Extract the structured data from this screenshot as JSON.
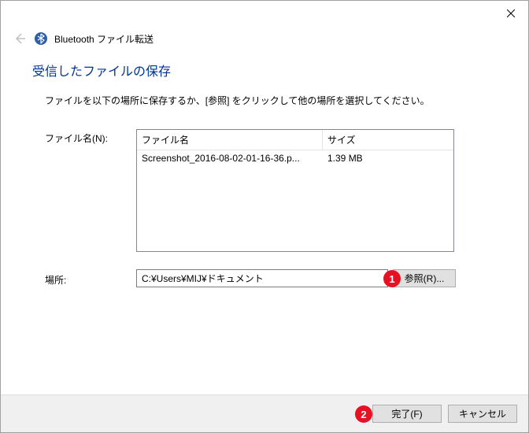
{
  "titlebar": {
    "close_aria": "閉じる"
  },
  "header": {
    "title": "Bluetooth ファイル転送"
  },
  "heading": "受信したファイルの保存",
  "instruction": "ファイルを以下の場所に保存するか、[参照] をクリックして他の場所を選択してください。",
  "labels": {
    "filename": "ファイル名(N):",
    "location": "場所:"
  },
  "filelist": {
    "headers": {
      "name": "ファイル名",
      "size": "サイズ"
    },
    "rows": [
      {
        "name": "Screenshot_2016-08-02-01-16-36.p...",
        "size": "1.39 MB"
      }
    ]
  },
  "location": {
    "value": "C:¥Users¥MIJ¥ドキュメント"
  },
  "buttons": {
    "browse": "参照(R)...",
    "finish": "完了(F)",
    "cancel": "キャンセル"
  },
  "markers": {
    "one": "1",
    "two": "2"
  }
}
